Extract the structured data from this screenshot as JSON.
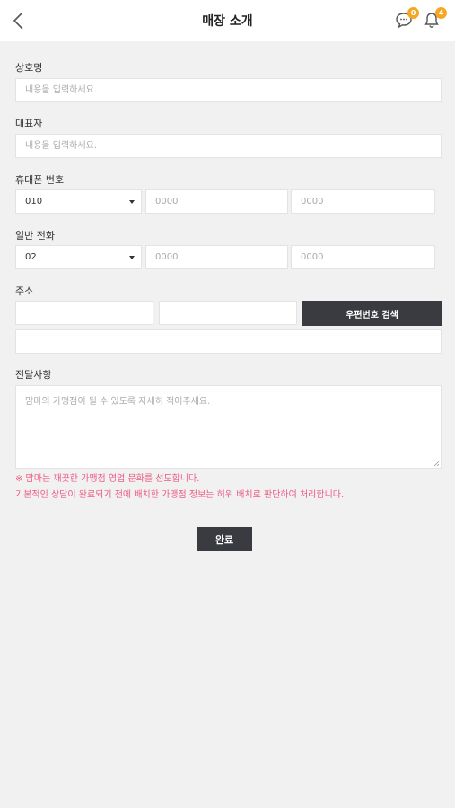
{
  "header": {
    "title": "매장 소개",
    "chat_badge": "0",
    "bell_badge": "4",
    "accent": "#f5a623"
  },
  "form": {
    "store_name": {
      "label": "상호명",
      "placeholder": "내용을 입력하세요."
    },
    "representative": {
      "label": "대표자",
      "placeholder": "내용을 입력하세요."
    },
    "mobile": {
      "label": "휴대폰 번호",
      "prefix": "010",
      "mid_placeholder": "0000",
      "last_placeholder": "0000"
    },
    "phone": {
      "label": "일반 전화",
      "prefix": "02",
      "mid_placeholder": "0000",
      "last_placeholder": "0000"
    },
    "address": {
      "label": "주소",
      "search_button": "우편번호 검색"
    },
    "message": {
      "label": "전달사항",
      "placeholder": "맘마의 가맹점이 될 수 있도록 자세히 적어주세요."
    }
  },
  "notice": {
    "line1": "※ 맘마는 깨끗한 가맹점 영업 문화를 선도합니다.",
    "line2": "기본적인 상담이 완료되기 전에 배치한 가맹점 정보는 허위 배치로 판단하여 처리합니다.",
    "color": "#ec5b84"
  },
  "submit_label": "완료"
}
